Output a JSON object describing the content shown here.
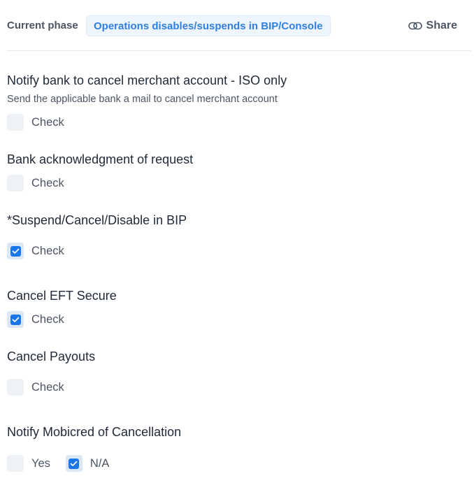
{
  "header": {
    "phase_label": "Current phase",
    "phase_value": "Operations disables/suspends in BIP/Console",
    "share_label": "Share",
    "share_icon": "link-icon"
  },
  "colors": {
    "accent": "#1976e8",
    "badge_text": "#2f7fe0",
    "badge_bg": "#eef5fd",
    "unchecked_box": "#eef2f7"
  },
  "sections": [
    {
      "title": "Notify bank to cancel merchant account - ISO only",
      "description": "Send the applicable bank a mail to cancel merchant account",
      "options": [
        {
          "label": "Check",
          "checked": false
        }
      ]
    },
    {
      "title": "Bank acknowledgment of request",
      "options": [
        {
          "label": "Check",
          "checked": false
        }
      ]
    },
    {
      "title": "*Suspend/Cancel/Disable in BIP",
      "options": [
        {
          "label": "Check",
          "checked": true
        }
      ]
    },
    {
      "title": "Cancel EFT Secure",
      "options": [
        {
          "label": "Check",
          "checked": true
        }
      ]
    },
    {
      "title": "Cancel Payouts",
      "options": [
        {
          "label": "Check",
          "checked": false
        }
      ]
    },
    {
      "title": "Notify Mobicred of Cancellation",
      "options": [
        {
          "label": "Yes",
          "checked": false
        },
        {
          "label": "N/A",
          "checked": true
        }
      ]
    }
  ]
}
